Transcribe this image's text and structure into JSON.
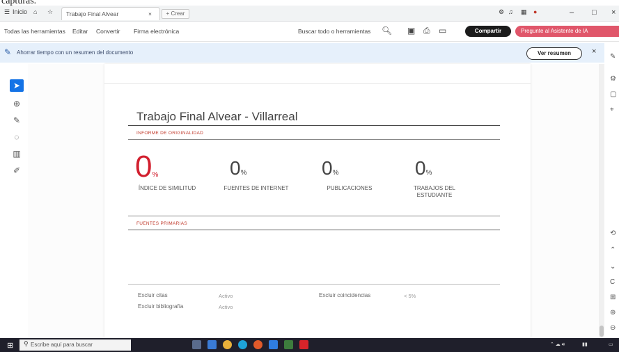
{
  "caption": "capturas.",
  "browser": {
    "menu_label": "Inicio",
    "tab_title": "Trabajo Final Alvear",
    "tab_close": "×",
    "new_tab": "+ Crear"
  },
  "toolbar": {
    "menu": [
      "Todas las herramientas",
      "Editar",
      "Convertir",
      "Firma electrónica"
    ],
    "search_tools": "Buscar todo o herramientas",
    "share": "Compartir",
    "ai_assistant": "Pregunte al Asistente de IA"
  },
  "banner": {
    "text": "Ahorrar tiempo con un resumen del documento",
    "button": "Ver resumen",
    "close": "×"
  },
  "document": {
    "title": "Trabajo Final Alvear - Villarreal",
    "originality_label": "INFORME DE ORIGINALIDAD",
    "stats": [
      {
        "value": "0",
        "unit": "%",
        "label": "ÍNDICE DE SIMILITUD"
      },
      {
        "value": "0",
        "unit": "%",
        "label": "FUENTES DE INTERNET"
      },
      {
        "value": "0",
        "unit": "%",
        "label": "PUBLICACIONES"
      },
      {
        "value": "0",
        "unit": "%",
        "label": "TRABAJOS DEL ESTUDIANTE"
      }
    ],
    "sources_label": "FUENTES PRIMARIAS",
    "footer": {
      "exclude_quotes_label": "Excluir citas",
      "exclude_quotes_value": "Activo",
      "exclude_bib_label": "Excluir bibliografía",
      "exclude_bib_value": "Activo",
      "exclude_matches_label": "Excluir coincidencias",
      "exclude_matches_value": "< 5%"
    }
  },
  "taskbar": {
    "search_placeholder": "Escribe aquí para buscar"
  },
  "colors": {
    "accent_red": "#e0566a",
    "similarity_red": "#d2202f",
    "banner_blue": "#e6f0fb",
    "tool_active": "#1473e6"
  }
}
